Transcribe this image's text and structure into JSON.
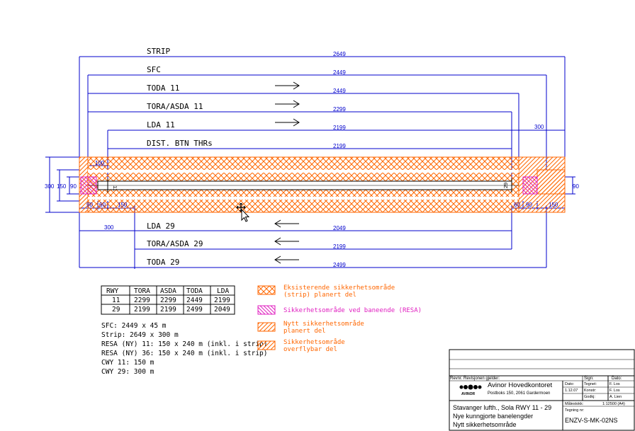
{
  "bars": [
    {
      "label": "STRIP",
      "value": "2649"
    },
    {
      "label": "SFC",
      "value": "2449"
    },
    {
      "label": "TODA 11",
      "value": "2449"
    },
    {
      "label": "TORA/ASDA 11",
      "value": "2299"
    },
    {
      "label": "LDA 11",
      "value": "2199"
    },
    {
      "label": "DIST. BTN THRs",
      "value": "2199"
    },
    {
      "label": "LDA 29",
      "value": "2049"
    },
    {
      "label": "TORA/ASDA 29",
      "value": "2199"
    },
    {
      "label": "TODA 29",
      "value": "2499"
    }
  ],
  "dims": {
    "d300_right": "300",
    "d100": "100",
    "d300_left": "300",
    "d150_left": "150",
    "d90_left": "90",
    "d90_bl": "90",
    "d60_bl": "60",
    "d150_bl": "150",
    "d300_bottom": "300",
    "d60_br": "60",
    "d90_br": "90",
    "d150_br": "150",
    "d90_right": "90",
    "thr11": "11",
    "thr29": "29"
  },
  "table": {
    "headers": [
      "RWY",
      "TORA",
      "ASDA",
      "TODA",
      "LDA"
    ],
    "rows": [
      [
        "11",
        "2299",
        "2299",
        "2449",
        "2199"
      ],
      [
        "29",
        "2199",
        "2199",
        "2499",
        "2049"
      ]
    ]
  },
  "legend": [
    {
      "text1": "Eksisterende sikkerhetsområde",
      "text2": "(strip) planert del"
    },
    {
      "text1": "Sikkerhetsområde ved baneende (RESA)",
      "text2": ""
    },
    {
      "text1": "Nytt sikkerhetsområde",
      "text2": "planert del"
    },
    {
      "text1": "Sikkerhetsområde",
      "text2": "overflybar del"
    }
  ],
  "notes": [
    "SFC: 2449 x 45 m",
    "Strip: 2649 x 300 m",
    "RESA (NY) 11: 150 x 240 m (inkl. i strip)",
    "RESA (NY) 36: 150 x 240 m (inkl. i strip)",
    "CWY 11: 150 m",
    "CWY 29: 300 m"
  ],
  "titleblock": {
    "revision_header": "Revnr. Revisjonen gjelder:",
    "signh": "Sign:",
    "datoh": "Dato:",
    "company": "Avinor Hovedkontoret",
    "address": "Postboks 150, 2061 Gardermoen",
    "logo": "AVINOR",
    "dato_label": "Dato:",
    "dato_value": "1.12.07",
    "tegnet_label": "Tegnet:",
    "tegnet_value": "F. Los",
    "konstr_label": "Konstr:",
    "konstr_value": "F. Los",
    "godkj_label": "Godkj:",
    "godkj_value": "A. Lien",
    "scale_label": "Målestokk:",
    "scale_value": "1:12500 (A4)",
    "drawing_label": "Tegning nr:",
    "drawing_no": "ENZV-S-MK-02NS",
    "title1": "Stavanger lufth., Sola RWY 11 - 29",
    "title2": "Nye kunngjorte banelengder",
    "title3": "Nytt sikkerhetsområde"
  },
  "colors": {
    "orange": "#ff6600",
    "magenta": "#e020c0",
    "blue": "#0000cc"
  }
}
